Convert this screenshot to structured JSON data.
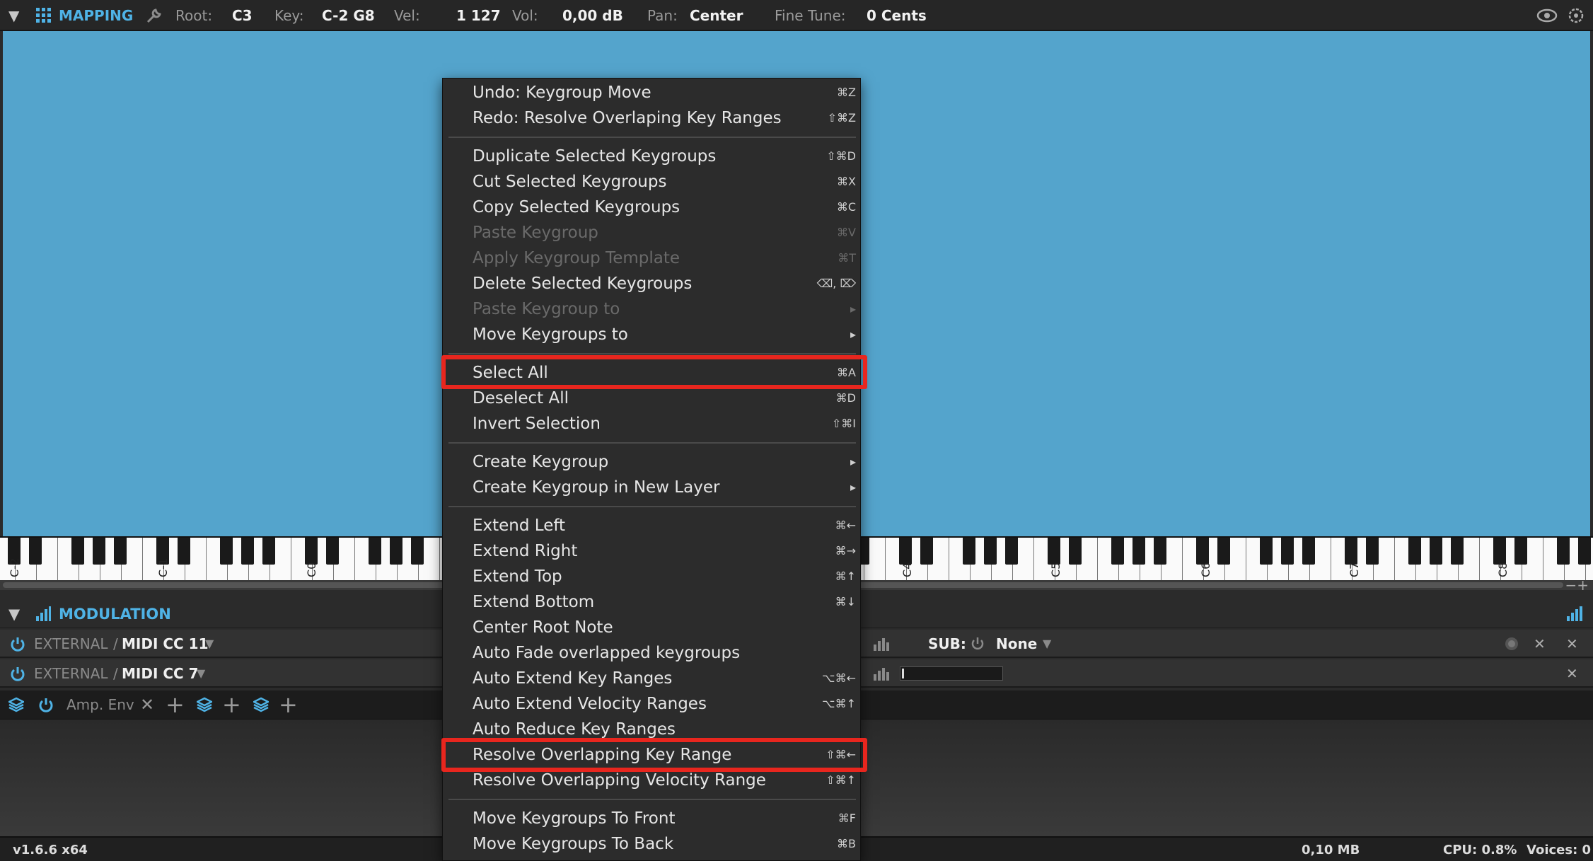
{
  "topbar": {
    "section": "MAPPING",
    "root_label": "Root:",
    "root_value": "C3",
    "key_label": "Key:",
    "key_value": "C-2 G8",
    "vel_label": "Vel:",
    "vel_value": "1 127",
    "vol_label": "Vol:",
    "vol_value": "0,00 dB",
    "pan_label": "Pan:",
    "pan_value": "Center",
    "finetune_label": "Fine Tune:",
    "finetune_value": "0 Cents"
  },
  "keyboard": {
    "octave_labels": [
      "C-2",
      "C-1",
      "C0",
      "C4",
      "C5",
      "C6",
      "C7",
      "C8"
    ]
  },
  "modulation": {
    "title": "MODULATION",
    "rows": [
      {
        "source": "EXTERNAL",
        "sep": "/",
        "name": "MIDI CC 11"
      },
      {
        "source": "EXTERNAL",
        "sep": "/",
        "name": "MIDI CC 7"
      }
    ],
    "sub_label": "SUB:",
    "sub_value": "None",
    "tab_label": "Amp. Env"
  },
  "status": {
    "version": "v1.6.6 x64",
    "memory": "0,10 MB",
    "cpu": "CPU: 0.8%",
    "voices": "Voices: 0"
  },
  "menu": {
    "items": [
      {
        "label": "Undo: Keygroup Move",
        "shortcut": "⌘Z",
        "disabled": false
      },
      {
        "label": "Redo: Resolve Overlaping Key Ranges",
        "shortcut": "⇧⌘Z",
        "disabled": false
      },
      {
        "label": "Duplicate Selected Keygroups",
        "shortcut": "⇧⌘D",
        "disabled": false
      },
      {
        "label": "Cut Selected Keygroups",
        "shortcut": "⌘X",
        "disabled": false
      },
      {
        "label": "Copy Selected Keygroups",
        "shortcut": "⌘C",
        "disabled": false
      },
      {
        "label": "Paste Keygroup",
        "shortcut": "⌘V",
        "disabled": true
      },
      {
        "label": "Apply Keygroup Template",
        "shortcut": "⌘T",
        "disabled": true
      },
      {
        "label": "Delete Selected Keygroups",
        "shortcut": "⌫, ⌦",
        "disabled": false
      },
      {
        "label": "Paste Keygroup to",
        "shortcut": "▸",
        "disabled": true
      },
      {
        "label": "Move Keygroups to",
        "shortcut": "▸",
        "disabled": false
      },
      {
        "label": "Select All",
        "shortcut": "⌘A",
        "disabled": false
      },
      {
        "label": "Deselect All",
        "shortcut": "⌘D",
        "disabled": false
      },
      {
        "label": "Invert Selection",
        "shortcut": "⇧⌘I",
        "disabled": false
      },
      {
        "label": "Create Keygroup",
        "shortcut": "▸",
        "disabled": false
      },
      {
        "label": "Create Keygroup in New Layer",
        "shortcut": "▸",
        "disabled": false
      },
      {
        "label": "Extend Left",
        "shortcut": "⌘←",
        "disabled": false
      },
      {
        "label": "Extend Right",
        "shortcut": "⌘→",
        "disabled": false
      },
      {
        "label": "Extend Top",
        "shortcut": "⌘↑",
        "disabled": false
      },
      {
        "label": "Extend Bottom",
        "shortcut": "⌘↓",
        "disabled": false
      },
      {
        "label": "Center Root Note",
        "shortcut": "",
        "disabled": false
      },
      {
        "label": "Auto Fade overlapped keygroups",
        "shortcut": "",
        "disabled": false
      },
      {
        "label": "Auto Extend Key Ranges",
        "shortcut": "⌥⌘←",
        "disabled": false
      },
      {
        "label": "Auto Extend Velocity Ranges",
        "shortcut": "⌥⌘↑",
        "disabled": false
      },
      {
        "label": "Auto Reduce Key Ranges",
        "shortcut": "",
        "disabled": false
      },
      {
        "label": "Resolve Overlapping Key Range",
        "shortcut": "⇧⌘←",
        "disabled": false
      },
      {
        "label": "Resolve Overlapping Velocity Range",
        "shortcut": "⇧⌘↑",
        "disabled": false
      },
      {
        "label": "Move Keygroups To Front",
        "shortcut": "⌘F",
        "disabled": false
      },
      {
        "label": "Move Keygroups To Back",
        "shortcut": "⌘B",
        "disabled": false
      }
    ]
  },
  "colors": {
    "accent": "#4fb3e6",
    "mapping_bg": "#54a4cc",
    "highlight": "#e8261e"
  }
}
